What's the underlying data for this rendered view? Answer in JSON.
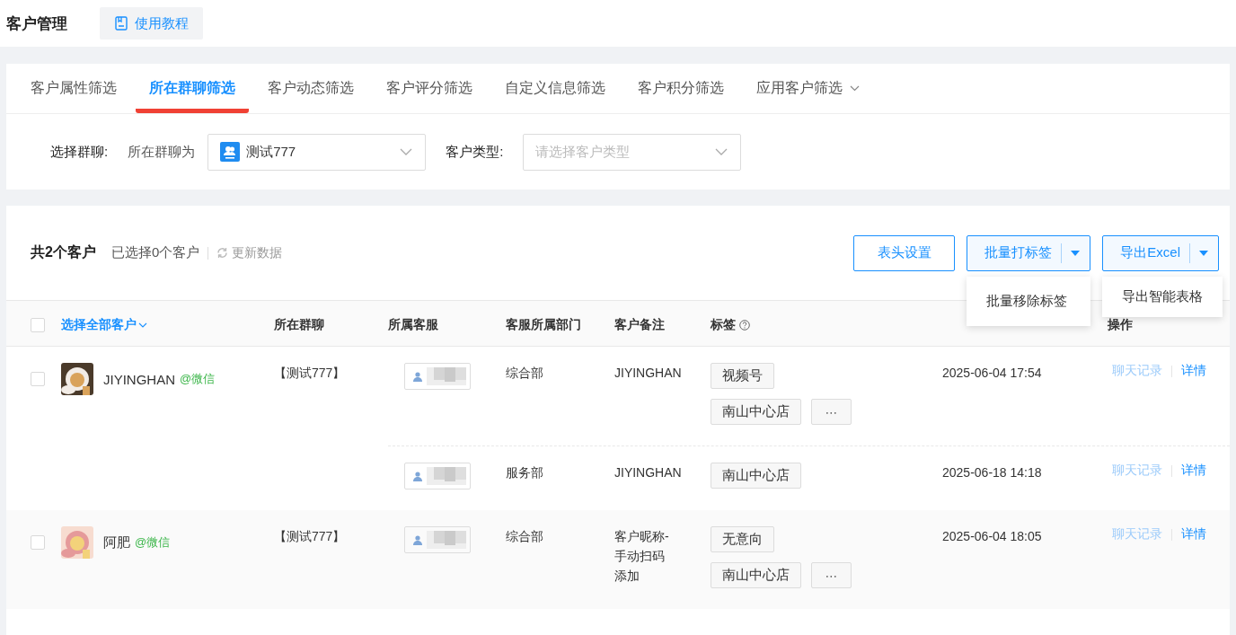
{
  "header": {
    "title": "客户管理",
    "tutorial_button": "使用教程"
  },
  "filter_tabs": [
    {
      "label": "客户属性筛选",
      "selected": false,
      "has_menu": false
    },
    {
      "label": "所在群聊筛选",
      "selected": true,
      "has_menu": false
    },
    {
      "label": "客户动态筛选",
      "selected": false,
      "has_menu": false
    },
    {
      "label": "客户评分筛选",
      "selected": false,
      "has_menu": false
    },
    {
      "label": "自定义信息筛选",
      "selected": false,
      "has_menu": false
    },
    {
      "label": "客户积分筛选",
      "selected": false,
      "has_menu": false
    },
    {
      "label": "应用客户筛选",
      "selected": false,
      "has_menu": true
    }
  ],
  "filters": {
    "group_label": "选择群聊:",
    "group_condition": "所在群聊为",
    "group_value": "测试777",
    "type_label": "客户类型:",
    "type_placeholder": "请选择客户类型"
  },
  "summary": {
    "total": "共2个客户",
    "selected": "已选择0个客户",
    "refresh": "更新数据"
  },
  "actions": [
    {
      "kind": "plain",
      "label": "表头设置"
    },
    {
      "kind": "split",
      "label": "批量打标签",
      "expanded": true,
      "menu": [
        "批量移除标签"
      ]
    },
    {
      "kind": "split",
      "label": "导出Excel",
      "expanded": true,
      "menu": [
        "导出智能表格"
      ]
    }
  ],
  "table": {
    "select_all": "选择全部客户",
    "select_all_checked": false,
    "columns": [
      "所在群聊",
      "所属客服",
      "客服所属部门",
      "客户备注",
      "标签",
      "操作"
    ],
    "rows": [
      {
        "checked": false,
        "name": "JIYINGHAN",
        "source": "@微信",
        "group": "【测试777】",
        "assignments": [
          {
            "dept": "综合部",
            "remark": "JIYINGHAN",
            "tag_lines": [
              [
                "视频号"
              ],
              [
                "南山中心店"
              ]
            ],
            "more_button": "⋯",
            "time": "2025-06-04 17:54",
            "ops": [
              {
                "label": "聊天记录",
                "disabled": true
              },
              {
                "label": "详情",
                "disabled": false
              }
            ]
          },
          {
            "dept": "服务部",
            "remark": "JIYINGHAN",
            "tag_lines": [
              [
                "南山中心店"
              ]
            ],
            "time": "2025-06-18 14:18",
            "ops": [
              {
                "label": "聊天记录",
                "disabled": true
              },
              {
                "label": "详情",
                "disabled": false
              }
            ]
          }
        ]
      },
      {
        "checked": false,
        "name": "阿肥",
        "source": "@微信",
        "group": "【测试777】",
        "assignments": [
          {
            "dept": "综合部",
            "remark": "客户昵称-手动扫码添加",
            "tag_lines": [
              [
                "无意向"
              ],
              [
                "南山中心店"
              ]
            ],
            "more_button": "⋯",
            "time": "2025-06-04 18:05",
            "ops": [
              {
                "label": "聊天记录",
                "disabled": true
              },
              {
                "label": "详情",
                "disabled": false
              }
            ]
          }
        ]
      }
    ]
  }
}
